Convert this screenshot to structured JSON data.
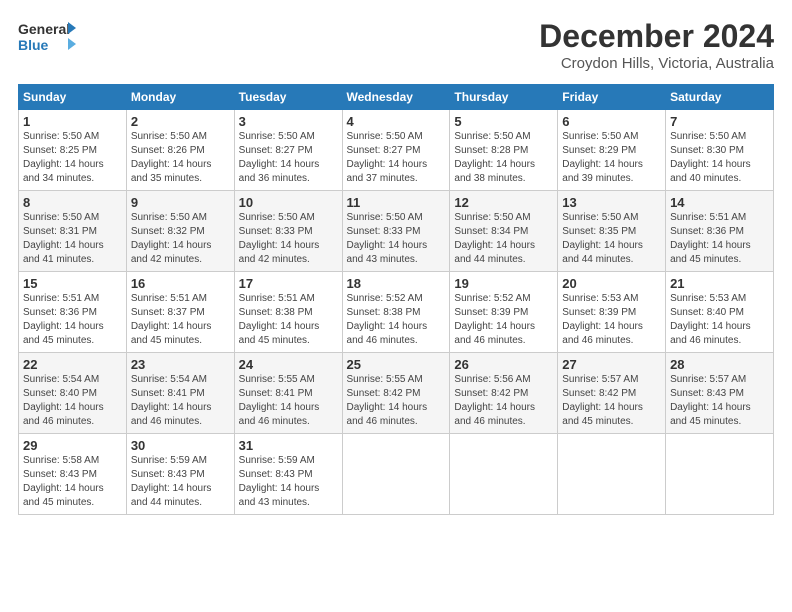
{
  "logo": {
    "line1": "General",
    "line2": "Blue"
  },
  "title": "December 2024",
  "location": "Croydon Hills, Victoria, Australia",
  "days_of_week": [
    "Sunday",
    "Monday",
    "Tuesday",
    "Wednesday",
    "Thursday",
    "Friday",
    "Saturday"
  ],
  "weeks": [
    [
      {
        "day": "1",
        "sunrise": "5:50 AM",
        "sunset": "8:25 PM",
        "daylight": "14 hours and 34 minutes."
      },
      {
        "day": "2",
        "sunrise": "5:50 AM",
        "sunset": "8:26 PM",
        "daylight": "14 hours and 35 minutes."
      },
      {
        "day": "3",
        "sunrise": "5:50 AM",
        "sunset": "8:27 PM",
        "daylight": "14 hours and 36 minutes."
      },
      {
        "day": "4",
        "sunrise": "5:50 AM",
        "sunset": "8:27 PM",
        "daylight": "14 hours and 37 minutes."
      },
      {
        "day": "5",
        "sunrise": "5:50 AM",
        "sunset": "8:28 PM",
        "daylight": "14 hours and 38 minutes."
      },
      {
        "day": "6",
        "sunrise": "5:50 AM",
        "sunset": "8:29 PM",
        "daylight": "14 hours and 39 minutes."
      },
      {
        "day": "7",
        "sunrise": "5:50 AM",
        "sunset": "8:30 PM",
        "daylight": "14 hours and 40 minutes."
      }
    ],
    [
      {
        "day": "8",
        "sunrise": "5:50 AM",
        "sunset": "8:31 PM",
        "daylight": "14 hours and 41 minutes."
      },
      {
        "day": "9",
        "sunrise": "5:50 AM",
        "sunset": "8:32 PM",
        "daylight": "14 hours and 42 minutes."
      },
      {
        "day": "10",
        "sunrise": "5:50 AM",
        "sunset": "8:33 PM",
        "daylight": "14 hours and 42 minutes."
      },
      {
        "day": "11",
        "sunrise": "5:50 AM",
        "sunset": "8:33 PM",
        "daylight": "14 hours and 43 minutes."
      },
      {
        "day": "12",
        "sunrise": "5:50 AM",
        "sunset": "8:34 PM",
        "daylight": "14 hours and 44 minutes."
      },
      {
        "day": "13",
        "sunrise": "5:50 AM",
        "sunset": "8:35 PM",
        "daylight": "14 hours and 44 minutes."
      },
      {
        "day": "14",
        "sunrise": "5:51 AM",
        "sunset": "8:36 PM",
        "daylight": "14 hours and 45 minutes."
      }
    ],
    [
      {
        "day": "15",
        "sunrise": "5:51 AM",
        "sunset": "8:36 PM",
        "daylight": "14 hours and 45 minutes."
      },
      {
        "day": "16",
        "sunrise": "5:51 AM",
        "sunset": "8:37 PM",
        "daylight": "14 hours and 45 minutes."
      },
      {
        "day": "17",
        "sunrise": "5:51 AM",
        "sunset": "8:38 PM",
        "daylight": "14 hours and 45 minutes."
      },
      {
        "day": "18",
        "sunrise": "5:52 AM",
        "sunset": "8:38 PM",
        "daylight": "14 hours and 46 minutes."
      },
      {
        "day": "19",
        "sunrise": "5:52 AM",
        "sunset": "8:39 PM",
        "daylight": "14 hours and 46 minutes."
      },
      {
        "day": "20",
        "sunrise": "5:53 AM",
        "sunset": "8:39 PM",
        "daylight": "14 hours and 46 minutes."
      },
      {
        "day": "21",
        "sunrise": "5:53 AM",
        "sunset": "8:40 PM",
        "daylight": "14 hours and 46 minutes."
      }
    ],
    [
      {
        "day": "22",
        "sunrise": "5:54 AM",
        "sunset": "8:40 PM",
        "daylight": "14 hours and 46 minutes."
      },
      {
        "day": "23",
        "sunrise": "5:54 AM",
        "sunset": "8:41 PM",
        "daylight": "14 hours and 46 minutes."
      },
      {
        "day": "24",
        "sunrise": "5:55 AM",
        "sunset": "8:41 PM",
        "daylight": "14 hours and 46 minutes."
      },
      {
        "day": "25",
        "sunrise": "5:55 AM",
        "sunset": "8:42 PM",
        "daylight": "14 hours and 46 minutes."
      },
      {
        "day": "26",
        "sunrise": "5:56 AM",
        "sunset": "8:42 PM",
        "daylight": "14 hours and 46 minutes."
      },
      {
        "day": "27",
        "sunrise": "5:57 AM",
        "sunset": "8:42 PM",
        "daylight": "14 hours and 45 minutes."
      },
      {
        "day": "28",
        "sunrise": "5:57 AM",
        "sunset": "8:43 PM",
        "daylight": "14 hours and 45 minutes."
      }
    ],
    [
      {
        "day": "29",
        "sunrise": "5:58 AM",
        "sunset": "8:43 PM",
        "daylight": "14 hours and 45 minutes."
      },
      {
        "day": "30",
        "sunrise": "5:59 AM",
        "sunset": "8:43 PM",
        "daylight": "14 hours and 44 minutes."
      },
      {
        "day": "31",
        "sunrise": "5:59 AM",
        "sunset": "8:43 PM",
        "daylight": "14 hours and 43 minutes."
      },
      null,
      null,
      null,
      null
    ]
  ],
  "labels": {
    "sunrise": "Sunrise:",
    "sunset": "Sunset:",
    "daylight": "Daylight:"
  }
}
